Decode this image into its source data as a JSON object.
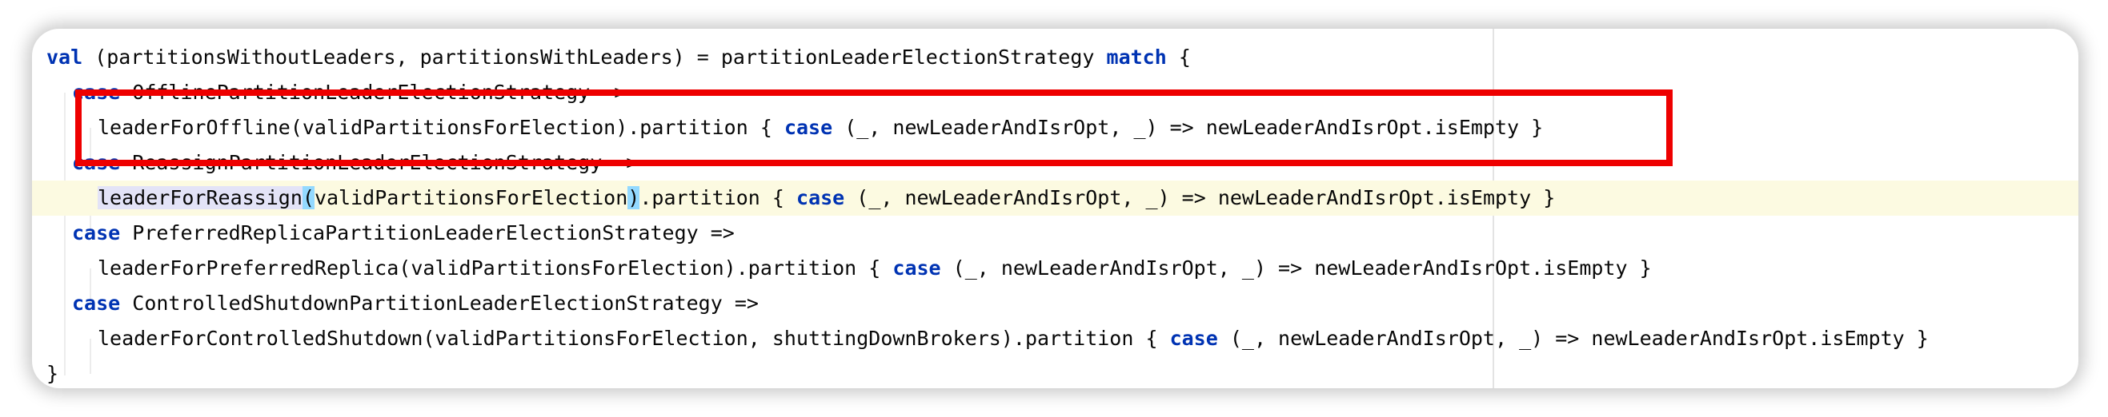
{
  "editor": {
    "lines": [
      {
        "tokens": [
          {
            "kind": "kw",
            "text": "val"
          },
          {
            "kind": "plain",
            "text": " (partitionsWithoutLeaders, partitionsWithLeaders) = partitionLeaderElectionStrategy "
          },
          {
            "kind": "kw",
            "text": "match"
          },
          {
            "kind": "plain",
            "text": " {"
          }
        ]
      },
      {
        "tokens": [
          {
            "kind": "kw",
            "text": "case"
          },
          {
            "kind": "plain",
            "text": " OfflinePartitionLeaderElectionStrategy =>"
          }
        ]
      },
      {
        "tokens": [
          {
            "kind": "plain",
            "text": "leaderForOffline(validPartitionsForElection).partition { "
          },
          {
            "kind": "kw",
            "text": "case"
          },
          {
            "kind": "plain",
            "text": " (_, newLeaderAndIsrOpt, _) => newLeaderAndIsrOpt.isEmpty }"
          }
        ]
      },
      {
        "tokens": [
          {
            "kind": "kw",
            "text": "case"
          },
          {
            "kind": "plain",
            "text": " ReassignPartitionLeaderElectionStrategy =>"
          }
        ]
      },
      {
        "tokens": [
          {
            "kind": "ident",
            "text": "leaderForReassign"
          },
          {
            "kind": "paren",
            "text": "("
          },
          {
            "kind": "plain",
            "text": "validPartitionsForElection"
          },
          {
            "kind": "paren",
            "text": ")"
          },
          {
            "kind": "plain",
            "text": ".partition { "
          },
          {
            "kind": "kw",
            "text": "case"
          },
          {
            "kind": "plain",
            "text": " (_, newLeaderAndIsrOpt, _) => newLeaderAndIsrOpt.isEmpty }"
          }
        ]
      },
      {
        "tokens": [
          {
            "kind": "kw",
            "text": "case"
          },
          {
            "kind": "plain",
            "text": " PreferredReplicaPartitionLeaderElectionStrategy =>"
          }
        ]
      },
      {
        "tokens": [
          {
            "kind": "plain",
            "text": "leaderForPreferredReplica(validPartitionsForElection).partition { "
          },
          {
            "kind": "kw",
            "text": "case"
          },
          {
            "kind": "plain",
            "text": " (_, newLeaderAndIsrOpt, _) => newLeaderAndIsrOpt.isEmpty }"
          }
        ]
      },
      {
        "tokens": [
          {
            "kind": "kw",
            "text": "case"
          },
          {
            "kind": "plain",
            "text": " ControlledShutdownPartitionLeaderElectionStrategy =>"
          }
        ]
      },
      {
        "tokens": [
          {
            "kind": "plain",
            "text": "leaderForControlledShutdown(validPartitionsForElection, shuttingDownBrokers).partition { "
          },
          {
            "kind": "kw",
            "text": "case"
          },
          {
            "kind": "plain",
            "text": " (_, newLeaderAndIsrOpt, _) => newLeaderAndIsrOpt.isEmpty }"
          }
        ]
      },
      {
        "tokens": [
          {
            "kind": "plain",
            "text": "}"
          }
        ]
      }
    ]
  },
  "colors": {
    "keyword": "#0033b3",
    "text": "#080808",
    "current_line": "#fcfae1",
    "annotation_box": "#ee0000",
    "paren_match": "#93d9ff",
    "identifier_highlight": "#e3e3f7"
  }
}
